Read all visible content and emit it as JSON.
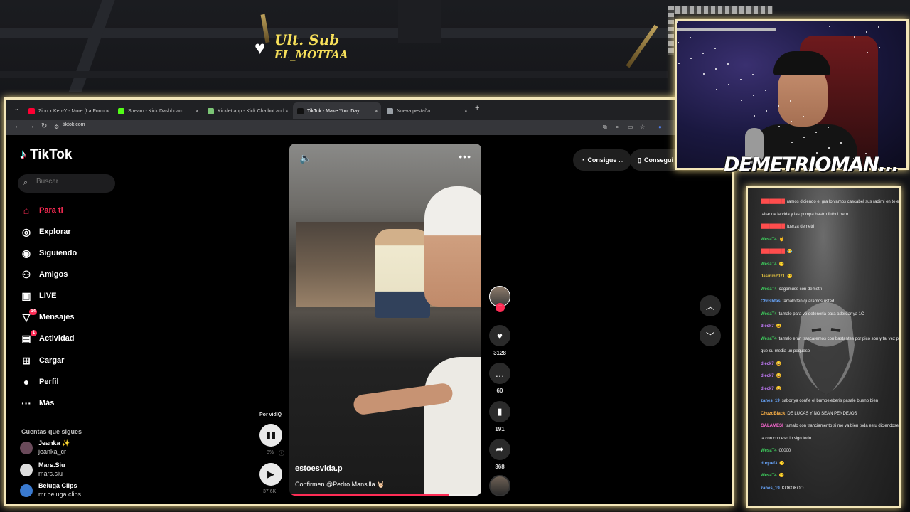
{
  "overlay": {
    "sub_label": "Ult. Sub",
    "sub_name": "EL_MOTTAA",
    "streamer_name": "DEMETRIOMAN..."
  },
  "browser": {
    "tabs": [
      {
        "label": "Zion x Ken-Y - More (La Formu...",
        "color": "#ff0033"
      },
      {
        "label": "Stream - Kick Dashboard",
        "color": "#53fc18"
      },
      {
        "label": "Kicklet.app - Kick Chatbot and ...",
        "color": "#7cc576"
      },
      {
        "label": "TikTok - Make Your Day",
        "color": "#111111"
      },
      {
        "label": "Nueva pestaña",
        "color": "#9aa0a6"
      }
    ],
    "new_tab": "+",
    "url": "tiktok.com"
  },
  "tiktok": {
    "logo": "TikTok",
    "search_placeholder": "Buscar",
    "nav": [
      {
        "label": "Para ti",
        "icon": "home-icon",
        "glyph": "⌂",
        "badge": ""
      },
      {
        "label": "Explorar",
        "icon": "compass-icon",
        "glyph": "◎",
        "badge": ""
      },
      {
        "label": "Siguiendo",
        "icon": "following-avatar-icon",
        "glyph": "◉",
        "badge": ""
      },
      {
        "label": "Amigos",
        "icon": "friends-icon",
        "glyph": "⚇",
        "badge": ""
      },
      {
        "label": "LIVE",
        "icon": "live-tv-icon",
        "glyph": "▣",
        "badge": ""
      },
      {
        "label": "Mensajes",
        "icon": "messages-icon",
        "glyph": "▽",
        "badge": "14"
      },
      {
        "label": "Actividad",
        "icon": "activity-icon",
        "glyph": "▤",
        "badge": "1"
      },
      {
        "label": "Cargar",
        "icon": "upload-icon",
        "glyph": "⊞",
        "badge": ""
      },
      {
        "label": "Perfil",
        "icon": "profile-icon",
        "glyph": "●",
        "badge": ""
      },
      {
        "label": "Más",
        "icon": "more-icon",
        "glyph": "···",
        "badge": ""
      }
    ],
    "following_title": "Cuentas que sigues",
    "following": [
      {
        "name": "Jeanka ✨",
        "handle": "jeanka_cr"
      },
      {
        "name": "Mars.Siu",
        "handle": "mars.siu"
      },
      {
        "name": "Beluga Clips",
        "handle": "mr.beluga.clips"
      }
    ],
    "video": {
      "author": "estoesvida.p",
      "caption": "Confirmen @Pedro Mansilla 🤘🏻",
      "progress": 0.83
    },
    "side_controls": {
      "by": "Por vidIQ",
      "percent": "8%",
      "views": "37.6K"
    },
    "actions": {
      "likes": "3128",
      "comments": "60",
      "saves": "191",
      "shares": "368"
    },
    "pills": [
      "Consigue ...",
      "Consegui"
    ]
  },
  "chat": {
    "messages": [
      {
        "user": "████████",
        "text": "ramos diciendo el gra lo vamos cascabel sus radimi en te el carro con palsabla con su auras",
        "color": "#ff4d4d"
      },
      {
        "user": "",
        "text": "taltar de la vida y las pompa bastro futbol pero",
        "color": "#ffffff"
      },
      {
        "user": "████████",
        "text": "fuerza demetri",
        "color": "#ff4d4d"
      },
      {
        "user": "WesaT4",
        "text": "🤘",
        "color": "#3fd35f"
      },
      {
        "user": "████████",
        "text": "😂",
        "color": "#ff4d4d"
      },
      {
        "user": "WesaT4",
        "text": "🙂",
        "color": "#3fd35f"
      },
      {
        "user": "Jasmin2071",
        "text": "🙂",
        "color": "#e0c040"
      },
      {
        "user": "WesaT4",
        "text": "cagamuss con demetri",
        "color": "#3fd35f"
      },
      {
        "user": "Chrisbtas",
        "text": "tamalo ten quaramos usted",
        "color": "#6aa8ff"
      },
      {
        "user": "WesaT4",
        "text": "tamalo para vo detenerla para aderdar ya 1C",
        "color": "#3fd35f"
      },
      {
        "user": "dieck7",
        "text": "😀",
        "color": "#c77dff"
      },
      {
        "user": "WesaT4",
        "text": "tamalo eran trascaremos con bastantes por pico son y tal vez plata mejor que la desplazas y",
        "color": "#3fd35f"
      },
      {
        "user": "",
        "text": "que su media un pequeso",
        "color": "#ffffff"
      },
      {
        "user": "dieck7",
        "text": "😀",
        "color": "#c77dff"
      },
      {
        "user": "dieck7",
        "text": "😀",
        "color": "#c77dff"
      },
      {
        "user": "dieck7",
        "text": "😀",
        "color": "#c77dff"
      },
      {
        "user": "zanes_19",
        "text": "sabor ya confie el bumbeleberis pasale bueno bien",
        "color": "#6aa8ff"
      },
      {
        "user": "ChuzoBlack",
        "text": "DE LUCAS Y NO SEAN PENDEJOS",
        "color": "#ffb347"
      },
      {
        "user": "GALAMESI",
        "text": "tamalo con tranciamento si me va bien toda estu diciendose a estonado sabor tum sacado esa que",
        "color": "#ff6ad5"
      },
      {
        "user": "",
        "text": "la con con eso lo sigo todo",
        "color": "#ffffff"
      },
      {
        "user": "WesaT4",
        "text": "00000",
        "color": "#3fd35f"
      },
      {
        "user": "duquef3",
        "text": "🙂",
        "color": "#6aa8ff"
      },
      {
        "user": "WesaT4",
        "text": "🙂",
        "color": "#3fd35f"
      },
      {
        "user": "zanes_19",
        "text": "KOKOKOO",
        "color": "#6aa8ff"
      }
    ]
  }
}
